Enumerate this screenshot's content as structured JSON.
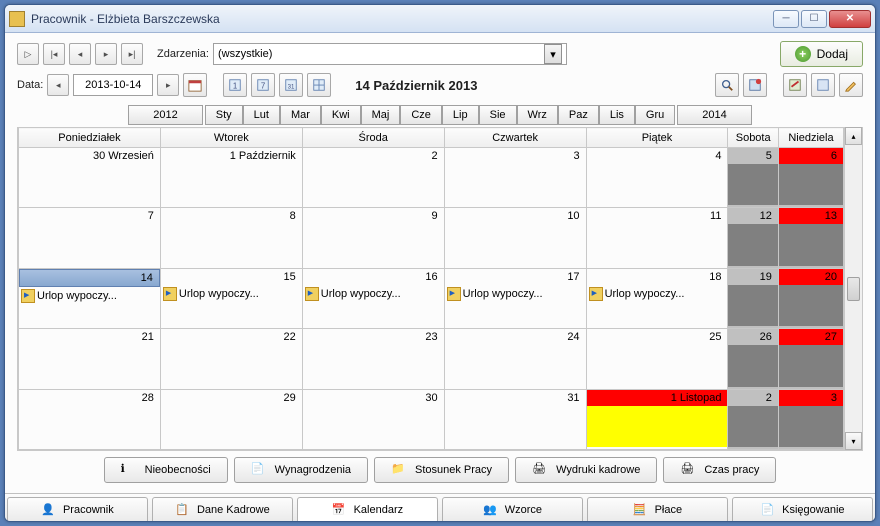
{
  "window": {
    "title": "Pracownik - Elżbieta Barszczewska"
  },
  "toolbar1": {
    "events_label": "Zdarzenia:",
    "events_filter": "(wszystkie)",
    "add_label": "Dodaj"
  },
  "toolbar2": {
    "date_label": "Data:",
    "date_value": "2013-10-14",
    "title": "14 Październik 2013"
  },
  "month_nav": {
    "prev_year": "2012",
    "next_year": "2014",
    "months": [
      "Sty",
      "Lut",
      "Mar",
      "Kwi",
      "Maj",
      "Cze",
      "Lip",
      "Sie",
      "Wrz",
      "Paz",
      "Lis",
      "Gru"
    ]
  },
  "days_header": [
    "Poniedziałek",
    "Wtorek",
    "Środa",
    "Czwartek",
    "Piątek",
    "Sobota",
    "Niedziela"
  ],
  "weeks": [
    [
      {
        "label": "30 Wrzesień"
      },
      {
        "label": "1 Październik"
      },
      {
        "label": "2"
      },
      {
        "label": "3"
      },
      {
        "label": "4"
      },
      {
        "label": "5",
        "sat": true
      },
      {
        "label": "6",
        "sun": true
      }
    ],
    [
      {
        "label": "7"
      },
      {
        "label": "8"
      },
      {
        "label": "9"
      },
      {
        "label": "10"
      },
      {
        "label": "11"
      },
      {
        "label": "12",
        "sat": true
      },
      {
        "label": "13",
        "sun": true
      }
    ],
    [
      {
        "label": "14",
        "selected": true,
        "event": "Urlop wypoczy..."
      },
      {
        "label": "15",
        "event": "Urlop wypoczy..."
      },
      {
        "label": "16",
        "event": "Urlop wypoczy..."
      },
      {
        "label": "17",
        "event": "Urlop wypoczy..."
      },
      {
        "label": "18",
        "event": "Urlop wypoczy..."
      },
      {
        "label": "19",
        "sat": true
      },
      {
        "label": "20",
        "sun": true
      }
    ],
    [
      {
        "label": "21"
      },
      {
        "label": "22"
      },
      {
        "label": "23"
      },
      {
        "label": "24"
      },
      {
        "label": "25"
      },
      {
        "label": "26",
        "sat": true
      },
      {
        "label": "27",
        "sun": true
      }
    ],
    [
      {
        "label": "28"
      },
      {
        "label": "29"
      },
      {
        "label": "30"
      },
      {
        "label": "31"
      },
      {
        "label": "1 Listopad",
        "holiday": true
      },
      {
        "label": "2",
        "sat": true
      },
      {
        "label": "3",
        "sun": true
      }
    ]
  ],
  "bottom_buttons": [
    "Nieobecności",
    "Wynagrodzenia",
    "Stosunek Pracy",
    "Wydruki kadrowe",
    "Czas pracy"
  ],
  "tabs": [
    "Pracownik",
    "Dane Kadrowe",
    "Kalendarz",
    "Wzorce",
    "Płace",
    "Księgowanie"
  ],
  "colors": {
    "sunday_header": "#ff0000",
    "weekend_body": "#808080",
    "holiday_body": "#ffff00"
  }
}
